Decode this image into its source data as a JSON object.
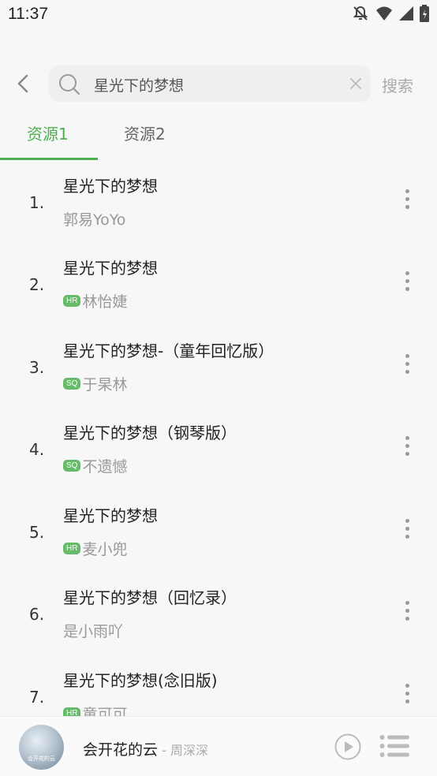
{
  "status": {
    "time": "11:37"
  },
  "search": {
    "query": "星光下的梦想",
    "submit_label": "搜索"
  },
  "tabs": [
    {
      "label": "资源1",
      "active": true
    },
    {
      "label": "资源2",
      "active": false
    }
  ],
  "songs": [
    {
      "num": "1.",
      "title": "星光下的梦想",
      "badge": "",
      "artist": "郭易YoYo"
    },
    {
      "num": "2.",
      "title": "星光下的梦想",
      "badge": "HR",
      "artist": "林怡婕"
    },
    {
      "num": "3.",
      "title": "星光下的梦想-（童年回忆版）",
      "badge": "SQ",
      "artist": "于杲林"
    },
    {
      "num": "4.",
      "title": "星光下的梦想（钢琴版）",
      "badge": "SQ",
      "artist": "不遗憾"
    },
    {
      "num": "5.",
      "title": "星光下的梦想",
      "badge": "HR",
      "artist": "麦小兜"
    },
    {
      "num": "6.",
      "title": "星光下的梦想（回忆录）",
      "badge": "",
      "artist": "是小雨吖"
    },
    {
      "num": "7.",
      "title": "星光下的梦想(念旧版)",
      "badge": "HR",
      "artist": "童可可"
    }
  ],
  "now_playing": {
    "title": "会开花的云",
    "artist": " - 周深深",
    "cover_text": "会开花的云"
  },
  "colors": {
    "accent": "#4caf50",
    "badge": "#66bb6a"
  }
}
